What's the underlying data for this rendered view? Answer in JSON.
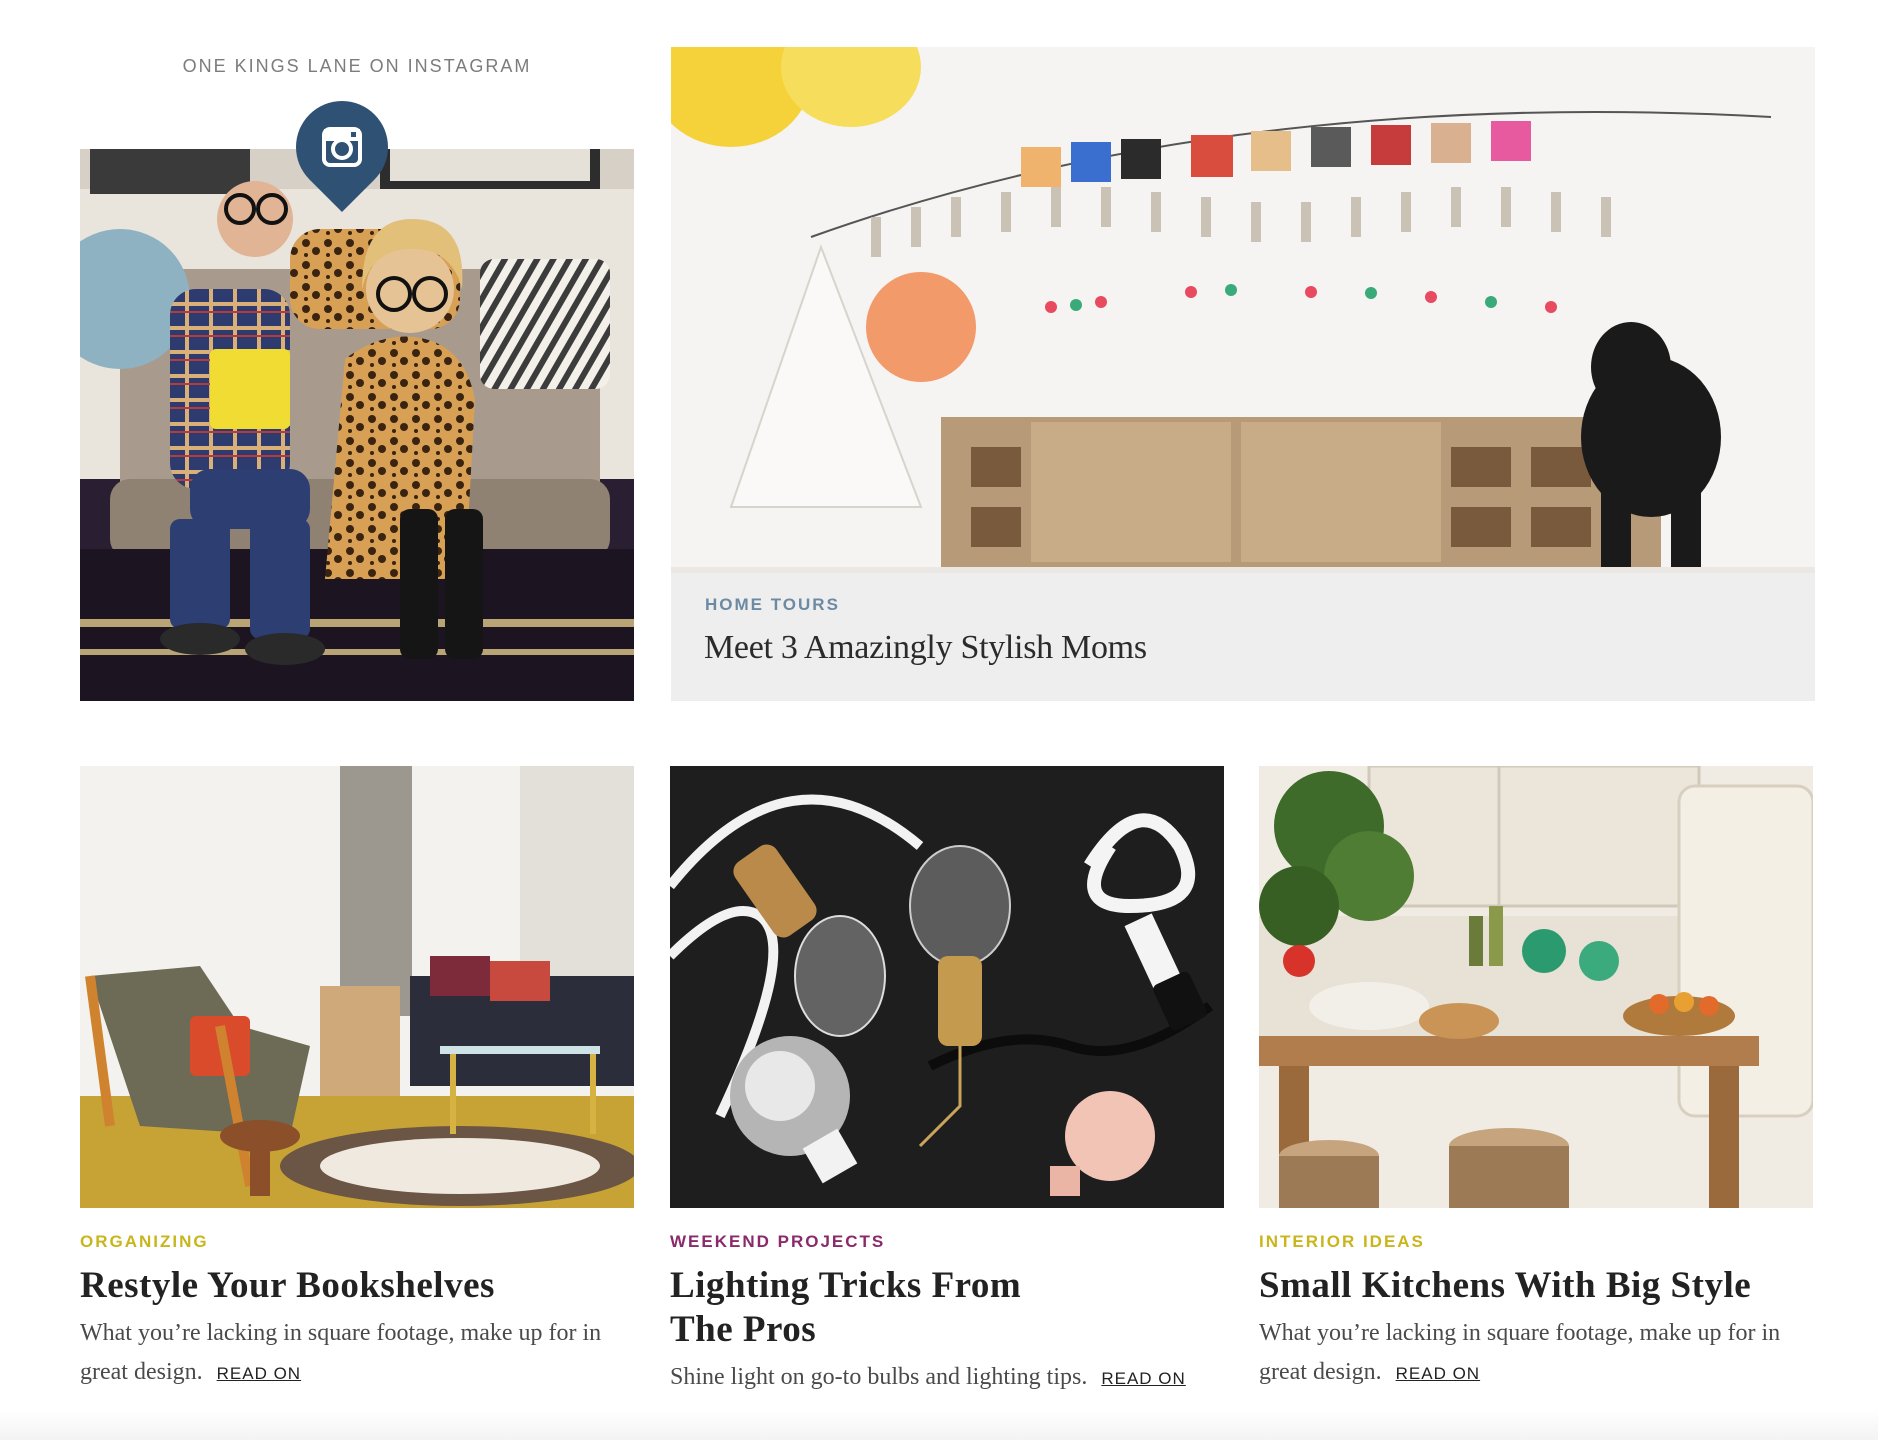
{
  "instagram": {
    "label": "ONE KINGS LANE ON INSTAGRAM",
    "icon": "instagram-icon",
    "badge_color": "#2f5274"
  },
  "feature": {
    "category": "HOME TOURS",
    "title": "Meet 3 Amazingly Stylish Moms",
    "category_color": "#6d8aa3"
  },
  "cards": [
    {
      "category": "ORGANIZING",
      "category_color": "#c9b51c",
      "title": "Restyle Your Bookshelves",
      "description": "What you’re lacking in square footage, make up for in great design.",
      "link": "READ ON"
    },
    {
      "category": "WEEKEND PROJECTS",
      "category_color": "#8a2a6b",
      "title": "Lighting Tricks From The Pros",
      "description": "Shine light on go-to bulbs and lighting tips.",
      "link": "READ ON"
    },
    {
      "category": "INTERIOR IDEAS",
      "category_color": "#c9b51c",
      "title": "Small Kitchens With Big Style",
      "description": "What you’re lacking in square footage, make up for in great design.",
      "link": "READ ON"
    }
  ]
}
